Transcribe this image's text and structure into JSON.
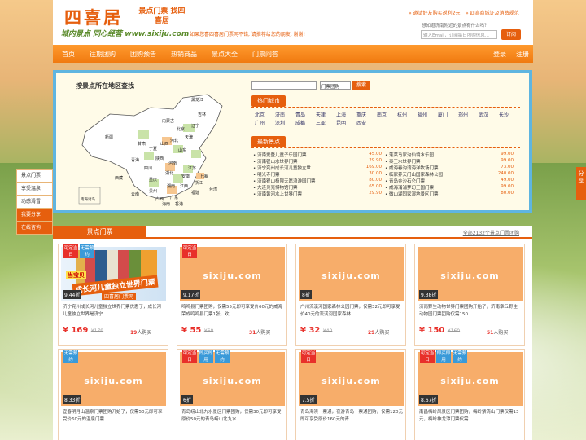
{
  "header": {
    "logo": "四喜居",
    "logo_sub": "景点门票 找四喜居",
    "slogan": "城内景点 同心经营 www.sixiju.com",
    "welcome": "如果您喜四喜居门票网不错, 请推荐给您的朋友, 谢谢!",
    "top_links": [
      "» 邀请好友购买返利2元",
      "» 四喜商城证及消费规范"
    ],
    "hint": "想知道济南附近的景点有什么吗？",
    "sub_placeholder": "输入Email，订阅每日团购信息...",
    "sub_btn": "订阅"
  },
  "nav": {
    "items": [
      "首页",
      "往期团购",
      "团购预告",
      "热销商品",
      "景点大全",
      "门票问答"
    ],
    "login": "登录",
    "register": "注册"
  },
  "map": {
    "title": "按景点所在地区查找",
    "legend": "南海诸岛",
    "provinces": [
      "黑龙江",
      "吉林",
      "辽宁",
      "内蒙古",
      "北京",
      "天津",
      "河北",
      "山西",
      "山东",
      "新疆",
      "甘肃",
      "宁夏",
      "陕西",
      "河南",
      "江苏",
      "青海",
      "西藏",
      "四川",
      "湖北",
      "安徽",
      "上海",
      "重庆",
      "浙江",
      "贵州",
      "湖南",
      "江西",
      "福建",
      "云南",
      "广西",
      "广东",
      "台湾",
      "海南",
      "香港"
    ]
  },
  "search": {
    "select": "门票团购",
    "btn": "搜索"
  },
  "hot_cities": {
    "title": "热门城市",
    "row1": [
      "北京",
      "济南",
      "青岛",
      "天津",
      "上海",
      "重庆",
      "南京",
      "杭州",
      "福州",
      "厦门",
      "郑州",
      "武汉",
      "长沙"
    ],
    "row2": [
      "广州",
      "深圳",
      "成都",
      "三亚",
      "昆明",
      "西安"
    ]
  },
  "latest": {
    "title": "最新景点",
    "left": [
      [
        "济南爱登儿童子乐园门票",
        "45.00"
      ],
      [
        "济南瞿山水世界门票",
        "29.90"
      ],
      [
        "济宁兖州成长河儿童独立世",
        "169.00"
      ],
      [
        "明光寺门票",
        "30.00"
      ],
      [
        "济南瞿山极限天愿浪游园门票",
        "80.00"
      ],
      [
        "大连贝壳博物馆门票",
        "65.00"
      ],
      [
        "济南黄河水上世界门票",
        "29.90"
      ]
    ],
    "right": [
      [
        "蓬莱马家沟仙境水乐园",
        "99.00"
      ],
      [
        "泰王水世界门票",
        "99.00"
      ],
      [
        "威海春沟湾海洋牧场门票",
        "73.00"
      ],
      [
        "临家养天门山国家森林公园",
        "240.00"
      ],
      [
        "青岛金沙石仑门票",
        "49.00"
      ],
      [
        "威海浦浦梦幻王国门票",
        "99.00"
      ],
      [
        "微山湖国家湿地景区门票",
        "80.00"
      ]
    ]
  },
  "sidebar": {
    "items": [
      "景点门票",
      "享受温泉",
      "动感滑雪",
      "我要分享",
      "在线咨询"
    ]
  },
  "share": "分享",
  "section": {
    "tab": "景点门票",
    "link": "全部2132个景点门票团购"
  },
  "cards": [
    {
      "badge1": "可定当日",
      "badge2": "无需预约",
      "discount": "9.44折",
      "desc": "济宁兖州成长河儿童独立世界门票优惠了，成长河儿童独立世界是济宁",
      "price": "¥ 169",
      "orig": "¥179",
      "sold": "19",
      "watermark": "sixiju.com",
      "photo": true,
      "photo_text": "成长河儿童独立世界门票",
      "photo_brand": "四喜居门票网",
      "photo_cap": "当宝贝"
    },
    {
      "badge1": "可定当日",
      "badge2": "",
      "discount": "9.17折",
      "desc": "鸣鸣县门票团购，仅需55元即可享受价60元的威海荣成鸣鸣县门票1张，欢",
      "price": "¥ 55",
      "orig": "¥60",
      "sold": "31",
      "watermark": "sixiju.com"
    },
    {
      "badge1": "",
      "badge2": "",
      "discount": "8折",
      "desc": "广州流溪河国家森林公园门票，仅需32元即可享受价40元的流溪河国家森林",
      "price": "¥ 32",
      "orig": "¥40",
      "sold": "29",
      "watermark": "sixiju.com"
    },
    {
      "badge1": "",
      "badge2": "",
      "discount": "9.38折",
      "desc": "济南野生动物世界门票团购开始了，济南章丘野生动物园门票团购仅需150",
      "price": "¥ 150",
      "orig": "¥160",
      "sold": "51",
      "watermark": "sixiju.com"
    },
    {
      "badge1": "",
      "badge2": "无需预约",
      "discount": "8.33折",
      "desc": "宜春明月山温泉门票团购开始了，仅需50元即可享受价60元的温泉门票",
      "price": "",
      "orig": "",
      "sold": "",
      "watermark": "sixiju.com"
    },
    {
      "badge1": "可定当日",
      "badge2": "即买即用",
      "badge3": "无需预约",
      "discount": "6折",
      "desc": "青岛崂山北九水景区门票团购，仅需30元即可享受原价50元的青岛崂山北九水",
      "price": "",
      "orig": "",
      "sold": "",
      "watermark": "sixiju.com"
    },
    {
      "badge1": "可定当日",
      "badge2": "",
      "discount": "7.5折",
      "desc": "青岛海滨一票通，夜游青岛一票通团购，仅需120元即可享受原价160元的青",
      "price": "",
      "orig": "",
      "sold": "",
      "watermark": "sixiju.com"
    },
    {
      "badge1": "可定当日",
      "badge2": "即买即用",
      "badge3": "无需预约",
      "discount": "8.67折",
      "desc": "南昌梅岭风景区门票团购，梅岭紫清山门票仅需13元，梅岭神龙潭门票仅需",
      "price": "",
      "orig": "",
      "sold": "",
      "watermark": "sixiju.com"
    }
  ],
  "sold_suffix": "人购买",
  "colors": {
    "accent": "#e65f0e",
    "frame": "#5fb5e0",
    "badge_red": "#e8302a",
    "badge_blue": "#3a9ad9"
  }
}
